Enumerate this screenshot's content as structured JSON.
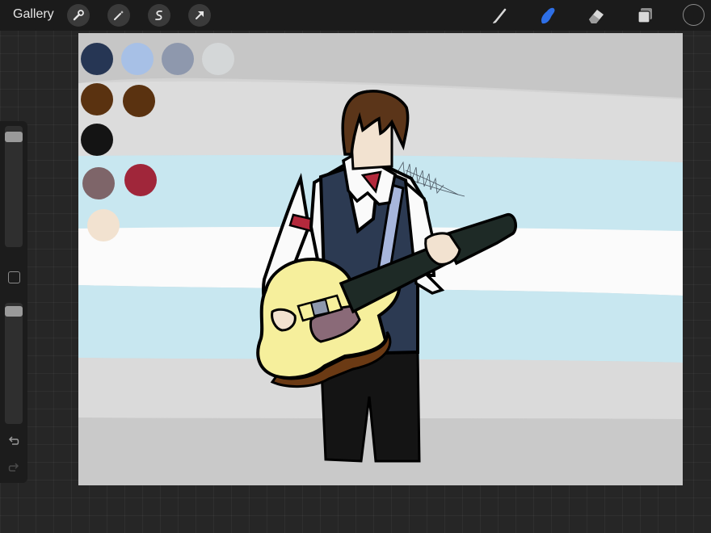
{
  "topbar": {
    "gallery_label": "Gallery",
    "actions_tool": "wrench-icon",
    "adjustments_tool": "magic-wand-icon",
    "selection_tool": "selection-s-icon",
    "transform_tool": "arrow-cursor-icon",
    "brush_tool": "brush-icon",
    "smudge_tool": "smudge-finger-icon",
    "eraser_tool": "eraser-icon",
    "layers_tool": "layers-icon",
    "color_picker": "color-circle-icon"
  },
  "sidebar": {
    "brush_size": 0.05,
    "opacity": 0.03,
    "modify_button": "square-icon",
    "undo": "undo-icon",
    "redo": "redo-icon"
  },
  "colors": {
    "active_tool": "#2e6fe6",
    "toolbar_bg": "#1b1b1b",
    "canvas_bg": "#d3d3d3",
    "stripe_blue": "#c8e7f0",
    "vest": "#2c3a52",
    "guitar_body": "#f6ef9c",
    "guitar_neck": "#1e2a26",
    "hair": "#5b3519",
    "skin": "#f2e2d0",
    "accent_red": "#b3293c",
    "strap": "#a7b6dc"
  },
  "palette_swatches": [
    "#263654",
    "#a7c0e6",
    "#8e98ad",
    "#d4d7d8",
    "#5a3210",
    "#5a3210",
    "#141414",
    "#7e6569",
    "#a0263a",
    "#f2e2d0"
  ]
}
